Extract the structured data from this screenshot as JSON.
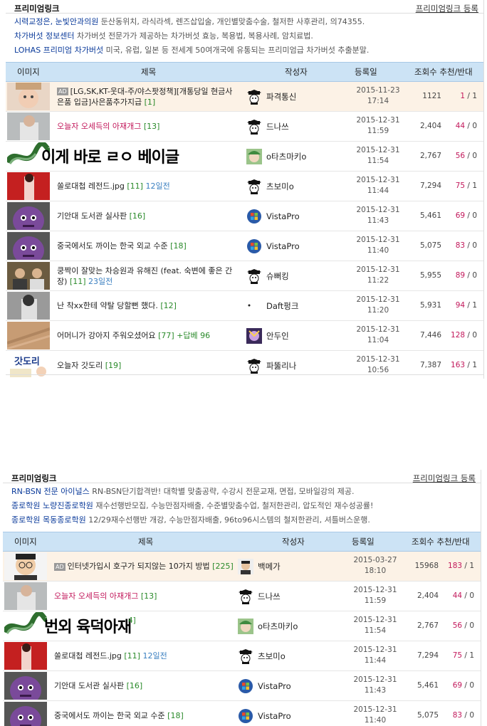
{
  "panel1": {
    "premium_title": "프리미엄링크",
    "premium_register": "프리미엄링크 등록",
    "premium_items": [
      {
        "link": "시력교정은, 눈빛안과의원",
        "desc": " 둔산동위치, 라식라섹, 렌즈삽입술, 개인별맞춤수술, 철저한 사후관리, 의74355."
      },
      {
        "link": "차가버섯 정보센터",
        "desc": " 차가버섯 전문가가 제공하는 차가버섯 효능, 복용법, 복용사례, 암치료법."
      },
      {
        "link": "LOHAS 프리미엄 차가버섯",
        "desc": " 미국, 유럽, 일본 등 전세계 50여개국에 유통되는 프리미엄급 차가버섯 추출분말."
      }
    ],
    "columns": {
      "image": "이미지",
      "title": "제목",
      "author": "작성자",
      "date": "등록일",
      "views_rec": "조회수 추천/반대"
    },
    "overlay_text": "이게 바로 ㄹㅇ 베이글",
    "rows": [
      {
        "ad": true,
        "badge": "AD",
        "title": "[LG,SK,KT-웃대-주/야스팟정책][개통당일 현금사은품 입금]사은품추가지급",
        "count": "[1]",
        "ago": "",
        "reply": "",
        "author": "파격통신",
        "avatar": "mortar",
        "date": "2015-11-23",
        "time": "17:14",
        "views": "1121",
        "up": "1",
        "down": "1",
        "red": false,
        "thumb": "baby"
      },
      {
        "ad": false,
        "title": "오늘자 오세득의 아재개그",
        "count": "[13]",
        "ago": "",
        "reply": "",
        "author": "드나쓰",
        "avatar": "mortar",
        "date": "2015-12-31",
        "time": "11:59",
        "views": "2,404",
        "up": "44",
        "down": "0",
        "red": true,
        "thumb": "man"
      },
      {
        "ad": false,
        "title": "",
        "count": "",
        "ago": "",
        "reply": "",
        "author": "o타츠마키o",
        "avatar": "anime",
        "date": "2015-12-31",
        "time": "11:54",
        "views": "2,767",
        "up": "56",
        "down": "0",
        "red": false,
        "thumb": "none"
      },
      {
        "ad": false,
        "title": "쏠로대첩 레전드.jpg",
        "count": "[11]",
        "ago": "12일전",
        "reply": "",
        "author": "츠보미o",
        "avatar": "mortar",
        "date": "2015-12-31",
        "time": "11:44",
        "views": "7,294",
        "up": "75",
        "down": "1",
        "red": false,
        "thumb": "red"
      },
      {
        "ad": false,
        "title": "기안대 도서관 실사판",
        "count": "[16]",
        "ago": "",
        "reply": "",
        "author": "VistaPro",
        "avatar": "windows",
        "date": "2015-12-31",
        "time": "11:43",
        "views": "5,461",
        "up": "69",
        "down": "0",
        "red": false,
        "thumb": "purple"
      },
      {
        "ad": false,
        "title": "중국에서도 까이는 한국 외교 수준",
        "count": "[18]",
        "ago": "",
        "reply": "",
        "author": "VistaPro",
        "avatar": "windows",
        "date": "2015-12-31",
        "time": "11:40",
        "views": "5,075",
        "up": "83",
        "down": "0",
        "red": false,
        "thumb": "purple"
      },
      {
        "ad": false,
        "title": "쿵짝이 잘맞는 차승원과 유해진 (feat. 숙변에 좋은 간장)",
        "count": "[11]",
        "ago": "23일전",
        "reply": "",
        "author": "슈뻐킹",
        "avatar": "mortar",
        "date": "2015-12-31",
        "time": "11:22",
        "views": "5,955",
        "up": "89",
        "down": "0",
        "red": false,
        "thumb": "men"
      },
      {
        "ad": false,
        "title": "난 착xx한테 약탈 당할뻔 했다.",
        "count": "[12]",
        "ago": "",
        "reply": "",
        "author": "Daft펑크",
        "avatar": "dot",
        "date": "2015-12-31",
        "time": "11:20",
        "views": "5,931",
        "up": "94",
        "down": "1",
        "red": false,
        "thumb": "bw"
      },
      {
        "ad": false,
        "title": "어머니가 강아지 주워오셨어요",
        "count": "[77]",
        "ago": "",
        "reply": "+답베 96",
        "author": "안두인",
        "avatar": "purplechar",
        "date": "2015-12-31",
        "time": "11:04",
        "views": "7,446",
        "up": "128",
        "down": "0",
        "red": false,
        "thumb": "wood"
      },
      {
        "ad": false,
        "title": "오늘자 갓도리",
        "count": "[19]",
        "ago": "",
        "reply": "",
        "author": "파뚫리나",
        "avatar": "mortar",
        "date": "2015-12-31",
        "time": "10:56",
        "views": "7,387",
        "up": "163",
        "down": "1",
        "red": false,
        "thumb": "comic"
      }
    ],
    "cut_date": "2015-12-31"
  },
  "panel2": {
    "premium_title": "프리미엄링크",
    "premium_register": "프리미엄링크 등록",
    "premium_items": [
      {
        "link": "RN-BSN 전문 아이널스",
        "desc": " RN-BSN단기합격반! 대학별 맞춤공략, 수강시 전문교재, 면접, 모바일강의 제공."
      },
      {
        "link": "종로학원 노량진종로학원",
        "desc": " 재수선행반모집, 수능만점자배출, 수준별맞춤수업, 철저한관리, 압도적인 재수성공률!"
      },
      {
        "link": "종로학원 목동종로학원",
        "desc": " 12/29재수선행반 개강, 수능만점자배출, 96to96시스템의 철저한관리, 셔틀버스운행."
      }
    ],
    "columns": {
      "image": "이미지",
      "title": "제목",
      "author": "작성자",
      "date": "등록일",
      "views_rec": "조회수 추천/반대"
    },
    "overlay_text": "번외 육덕아재",
    "overlay_tail": "4]",
    "rows": [
      {
        "ad": true,
        "badge": "AD",
        "title": "인터넷가입시 호구가 되지않는 10가지 방법",
        "count": "[225]",
        "ago": "",
        "reply": "",
        "author": "백메가",
        "avatar": "face",
        "date": "2015-03-27",
        "time": "18:10",
        "views": "15968",
        "up": "183",
        "down": "1",
        "red": false,
        "thumb": "glasses"
      },
      {
        "ad": false,
        "title": "오늘자 오세득의 아재개그",
        "count": "[13]",
        "ago": "",
        "reply": "",
        "author": "드나쓰",
        "avatar": "mortar",
        "date": "2015-12-31",
        "time": "11:59",
        "views": "2,404",
        "up": "44",
        "down": "0",
        "red": true,
        "thumb": "man"
      },
      {
        "ad": false,
        "title": "",
        "count": "",
        "ago": "",
        "reply": "",
        "author": "o타츠마키o",
        "avatar": "anime",
        "date": "2015-12-31",
        "time": "11:54",
        "views": "2,767",
        "up": "56",
        "down": "0",
        "red": false,
        "thumb": "none"
      },
      {
        "ad": false,
        "title": "쏠로대첩 레전드.jpg",
        "count": "[11]",
        "ago": "12일전",
        "reply": "",
        "author": "츠보미o",
        "avatar": "mortar",
        "date": "2015-12-31",
        "time": "11:44",
        "views": "7,294",
        "up": "75",
        "down": "1",
        "red": false,
        "thumb": "red"
      },
      {
        "ad": false,
        "title": "기안대 도서관 실사판",
        "count": "[16]",
        "ago": "",
        "reply": "",
        "author": "VistaPro",
        "avatar": "windows",
        "date": "2015-12-31",
        "time": "11:43",
        "views": "5,461",
        "up": "69",
        "down": "0",
        "red": false,
        "thumb": "purple"
      },
      {
        "ad": false,
        "title": "중국에서도 까이는 한국 외교 수준",
        "count": "[18]",
        "ago": "",
        "reply": "",
        "author": "VistaPro",
        "avatar": "windows",
        "date": "2015-12-31",
        "time": "11:40",
        "views": "5,075",
        "up": "83",
        "down": "0",
        "red": false,
        "thumb": "purple"
      }
    ]
  }
}
